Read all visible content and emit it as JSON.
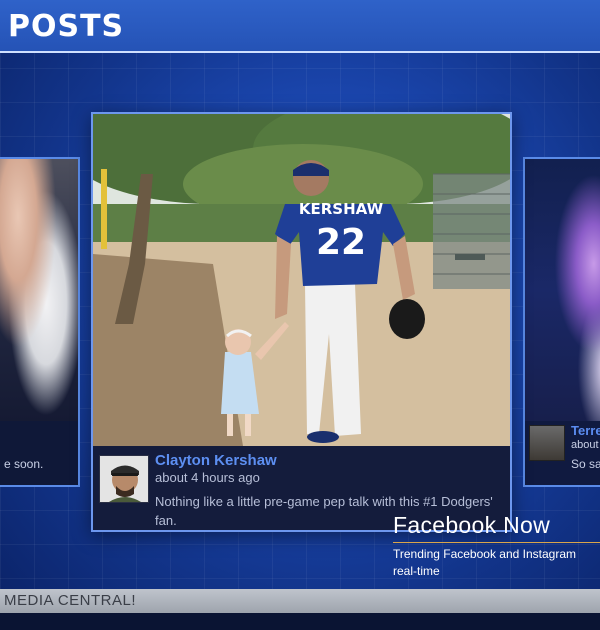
{
  "header": {
    "title": "POSTS"
  },
  "side_left": {
    "caption": "e soon."
  },
  "side_right": {
    "name": "Terre",
    "time": "about",
    "text": "So sad"
  },
  "main_post": {
    "author": "Clayton Kershaw",
    "time": "about 4 hours ago",
    "text": "Nothing like a little pre-game pep talk with this #1 Dodgers' fan.",
    "jersey_name": "KERSHAW",
    "jersey_number": "22"
  },
  "promo": {
    "title": "Facebook Now",
    "subtitle_line1": "Trending Facebook and Instagram",
    "subtitle_line2": "real-time"
  },
  "ticker": {
    "text": "MEDIA CENTRAL!"
  },
  "colors": {
    "accent_blue": "#5d8ff2",
    "header_bg": "#2553b6",
    "promo_rule": "#d9a54b"
  }
}
